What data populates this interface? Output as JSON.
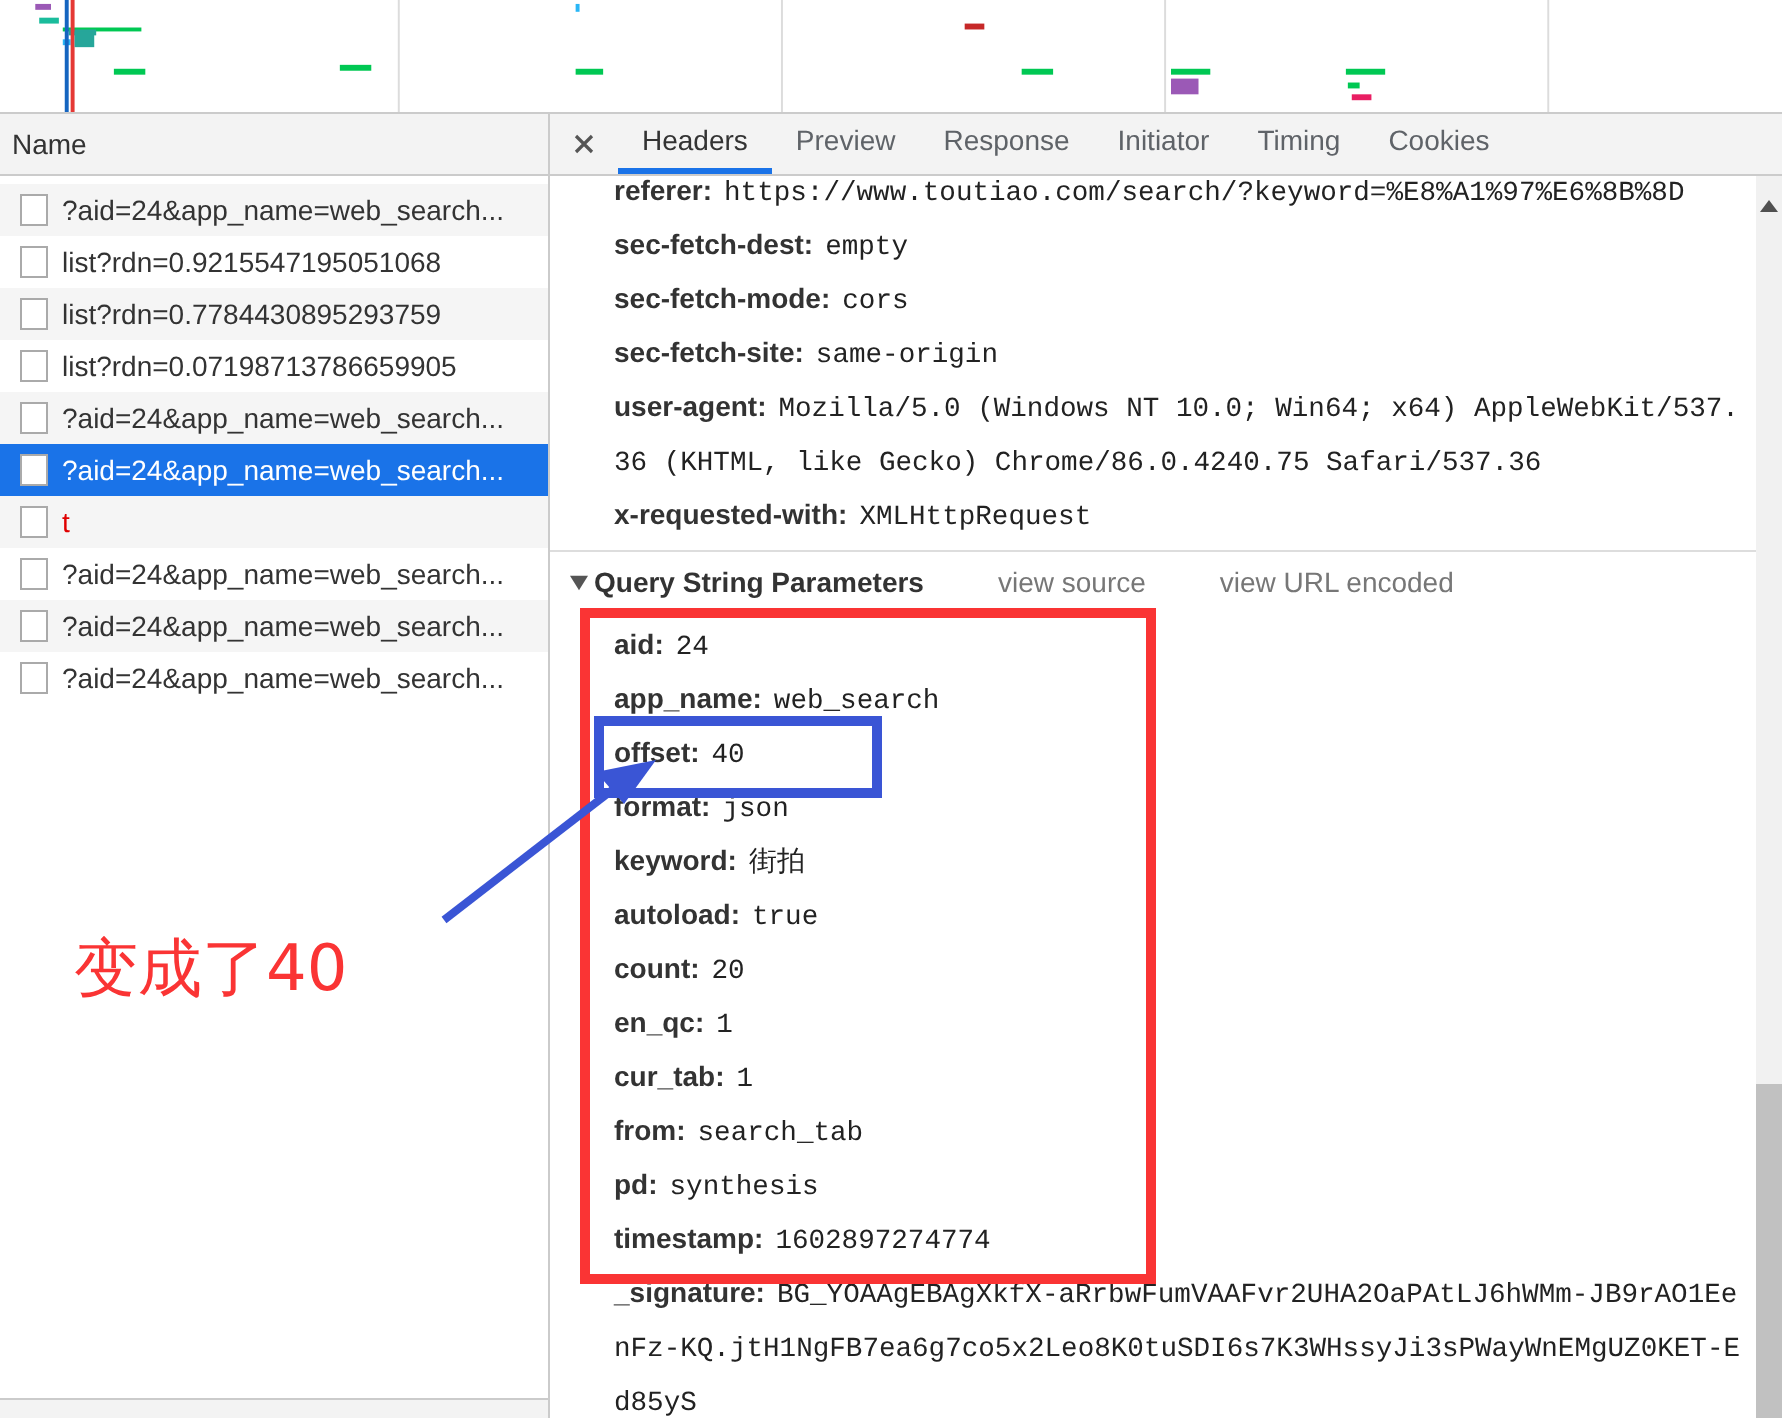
{
  "network_list": {
    "column_header": "Name",
    "requests": [
      {
        "name": "?aid=24&app_name=web_search...",
        "selected": false,
        "failed": false
      },
      {
        "name": "list?rdn=0.9215547195051068",
        "selected": false,
        "failed": false
      },
      {
        "name": "list?rdn=0.7784430895293759",
        "selected": false,
        "failed": false
      },
      {
        "name": "list?rdn=0.07198713786659905",
        "selected": false,
        "failed": false
      },
      {
        "name": "?aid=24&app_name=web_search...",
        "selected": false,
        "failed": false
      },
      {
        "name": "?aid=24&app_name=web_search...",
        "selected": true,
        "failed": false
      },
      {
        "name": "t",
        "selected": false,
        "failed": true
      },
      {
        "name": "?aid=24&app_name=web_search...",
        "selected": false,
        "failed": false
      },
      {
        "name": "?aid=24&app_name=web_search...",
        "selected": false,
        "failed": false
      },
      {
        "name": "?aid=24&app_name=web_search...",
        "selected": false,
        "failed": false
      }
    ]
  },
  "detail": {
    "tabs": [
      {
        "label": "Headers",
        "selected": true
      },
      {
        "label": "Preview",
        "selected": false
      },
      {
        "label": "Response",
        "selected": false
      },
      {
        "label": "Initiator",
        "selected": false
      },
      {
        "label": "Timing",
        "selected": false
      },
      {
        "label": "Cookies",
        "selected": false
      }
    ],
    "request_headers": [
      {
        "key": "referer:",
        "value": "https://www.toutiao.com/search/?keyword=%E8%A1%97%E6%8B%8D"
      },
      {
        "key": "sec-fetch-dest:",
        "value": "empty"
      },
      {
        "key": "sec-fetch-mode:",
        "value": "cors"
      },
      {
        "key": "sec-fetch-site:",
        "value": "same-origin"
      },
      {
        "key": "user-agent:",
        "value": "Mozilla/5.0 (Windows NT 10.0; Win64; x64) AppleWebKit/537.36 (KHTML, like Gecko) Chrome/86.0.4240.75 Safari/537.36"
      },
      {
        "key": "x-requested-with:",
        "value": "XMLHttpRequest"
      }
    ],
    "query_section": {
      "title": "Query String Parameters",
      "expanded": true,
      "links": [
        "view source",
        "view URL encoded"
      ],
      "params": [
        {
          "key": "aid:",
          "value": "24"
        },
        {
          "key": "app_name:",
          "value": "web_search"
        },
        {
          "key": "offset:",
          "value": "40"
        },
        {
          "key": "format:",
          "value": "json"
        },
        {
          "key": "keyword:",
          "value": "街拍"
        },
        {
          "key": "autoload:",
          "value": "true"
        },
        {
          "key": "count:",
          "value": "20"
        },
        {
          "key": "en_qc:",
          "value": "1"
        },
        {
          "key": "cur_tab:",
          "value": "1"
        },
        {
          "key": "from:",
          "value": "search_tab"
        },
        {
          "key": "pd:",
          "value": "synthesis"
        },
        {
          "key": "timestamp:",
          "value": "1602897274774"
        },
        {
          "key": "_signature:",
          "value": "BG_YOAAgEBAgXkfX-aRrbwFumVAAFvr2UHA2OaPAtLJ6hWMm-JB9rAO1EenFz-KQ.jtH1NgFB7ea6g7co5x2Leo8K0tuSDI6s7K3WHssyJi3sPWayWnEMgUZ0KET-Ed85yS"
        }
      ]
    }
  },
  "annotation": {
    "label": "变成了40"
  }
}
